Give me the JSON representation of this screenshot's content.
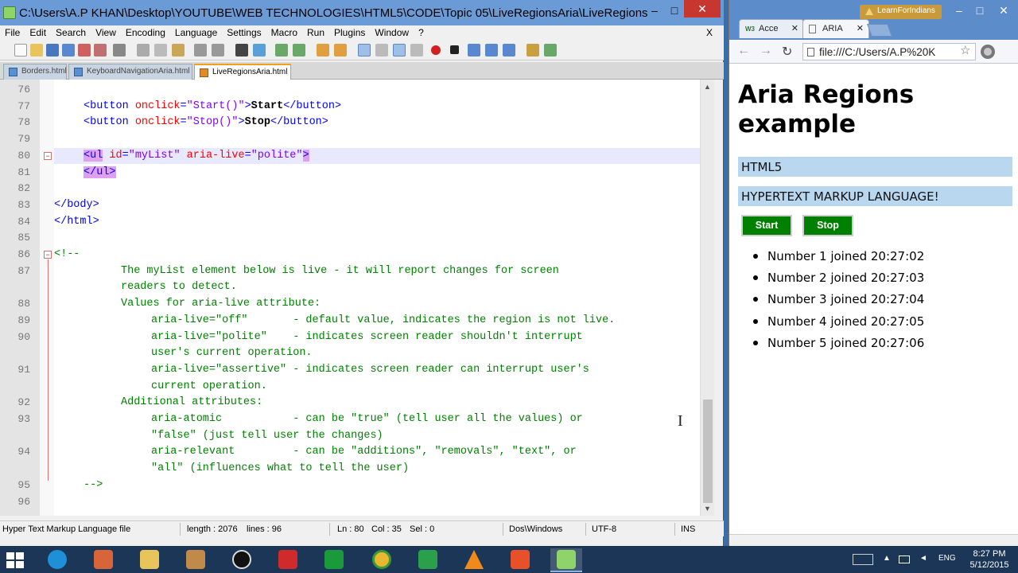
{
  "npp": {
    "title": "C:\\Users\\A.P KHAN\\Desktop\\YOUTUBE\\WEB TECHNOLOGIES\\HTML5\\CODE\\Topic 05\\LiveRegionsAria\\LiveRegionsAria.html...",
    "menu": [
      "File",
      "Edit",
      "Search",
      "View",
      "Encoding",
      "Language",
      "Settings",
      "Macro",
      "Run",
      "Plugins",
      "Window",
      "?"
    ],
    "doc_close": "X",
    "tabs": [
      "Borders.html",
      "KeyboardNavigationAria.html",
      "LiveRegionsAria.html"
    ],
    "lines": {
      "n76": "76",
      "n77": "77",
      "n78": "78",
      "n79": "79",
      "n80": "80",
      "n81": "81",
      "n82": "82",
      "n83": "83",
      "n84": "84",
      "n85": "85",
      "n86": "86",
      "n87": "87",
      "n88": "88",
      "n89": "89",
      "n90": "90",
      "n91": "91",
      "n92": "92",
      "n93": "93",
      "n94": "94",
      "n95": "95",
      "n96": "96"
    },
    "code": {
      "l77_tag1": "<button ",
      "l77_attr": "onclick",
      "l77_eq": "=",
      "l77_val": "\"Start()\"",
      "l77_tag2": ">",
      "l77_text": "Start",
      "l77_tag3": "</button>",
      "l78_tag1": "<button ",
      "l78_attr": "onclick",
      "l78_eq": "=",
      "l78_val": "\"Stop()\"",
      "l78_tag2": ">",
      "l78_text": "Stop",
      "l78_tag3": "</button>",
      "l80_tag1": "<ul",
      "l80_attr1": "id",
      "l80_val1": "\"myList\"",
      "l80_attr2": "aria-live",
      "l80_val2": "\"polite\"",
      "l80_tag2": ">",
      "l81_tag": "</ul>",
      "l83_tag": "</body>",
      "l84_tag": "</html>",
      "l86_cmt": "<!--",
      "l87a": "The myList element below is live - it will report changes for screen",
      "l87b": "readers to detect.",
      "l88": "Values for aria-live attribute:",
      "l89": "aria-live=\"off\"       - default value, indicates the region is not live.",
      "l90a": "aria-live=\"polite\"    - indicates screen reader shouldn't interrupt",
      "l90b": "user's current operation.",
      "l91a": "aria-live=\"assertive\" - indicates screen reader can interrupt user's",
      "l91b": "current operation.",
      "l92": "Additional attributes:",
      "l93a": "aria-atomic           - can be \"true\" (tell user all the values) or",
      "l93b": "\"false\" (just tell user the changes)",
      "l94a": "aria-relevant         - can be \"additions\", \"removals\", \"text\", or",
      "l94b": "\"all\" (influences what to tell the user)",
      "l95": "-->"
    },
    "status": {
      "file_type": "Hyper Text Markup Language file",
      "length": "length : 2076",
      "lines": "lines : 96",
      "ln": "Ln : 80",
      "col": "Col : 35",
      "sel": "Sel : 0",
      "eol": "Dos\\Windows",
      "encoding": "UTF-8",
      "mode": "INS"
    }
  },
  "chrome": {
    "profile": "LearnForIndians",
    "tabs": [
      {
        "fav": "W3",
        "label": "Acce"
      },
      {
        "fav": "",
        "label": "ARIA"
      }
    ],
    "url": "file:///C:/Users/A.P%20K",
    "page": {
      "heading": "Aria Regions example",
      "section1": "HTML5",
      "section2": "HYPERTEXT MARKUP LANGUAGE!",
      "start_label": "Start",
      "stop_label": "Stop",
      "items": [
        "Number 1 joined 20:27:02",
        "Number 2 joined 20:27:03",
        "Number 3 joined 20:27:04",
        "Number 4 joined 20:27:05",
        "Number 5 joined 20:27:06"
      ]
    }
  },
  "taskbar": {
    "lang": "ENG",
    "time": "8:27 PM",
    "date": "5/12/2015"
  },
  "icons": {
    "back": "back-arrow-icon",
    "forward": "forward-arrow-icon",
    "reload": "reload-icon",
    "bookmark": "star-icon",
    "menu": "hamburger-menu-icon"
  },
  "colors": {
    "npp_title": "#6b9bd6",
    "chrome_frame": "#5d8cca",
    "section_bg": "#b9d7ef",
    "button_green": "#008000",
    "taskbar": "#1b3656"
  }
}
